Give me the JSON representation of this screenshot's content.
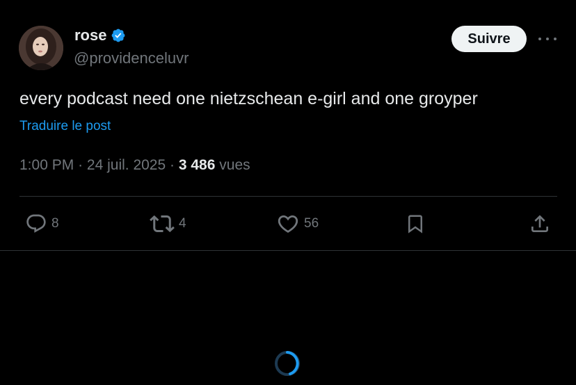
{
  "post": {
    "author": {
      "display_name": "rose",
      "handle": "@providenceluvr",
      "verified": true
    },
    "follow_label": "Suivre",
    "text": "every podcast need one nietzschean e-girl and one groyper",
    "translate_label": "Traduire le post",
    "time": "1:00 PM",
    "date": "24 juil. 2025",
    "separator": "·",
    "views_count": "3 486",
    "views_label": "vues"
  },
  "actions": {
    "replies": "8",
    "reposts": "4",
    "likes": "56"
  },
  "colors": {
    "background": "#000000",
    "text_primary": "#e7e9ea",
    "text_secondary": "#71767b",
    "accent": "#1d9bf0",
    "follow_bg": "#eff3f4",
    "divider": "#2f3336"
  },
  "icons": [
    "verified-badge-icon",
    "more-icon",
    "reply-icon",
    "repost-icon",
    "like-icon",
    "bookmark-icon",
    "share-icon",
    "loading-spinner"
  ]
}
